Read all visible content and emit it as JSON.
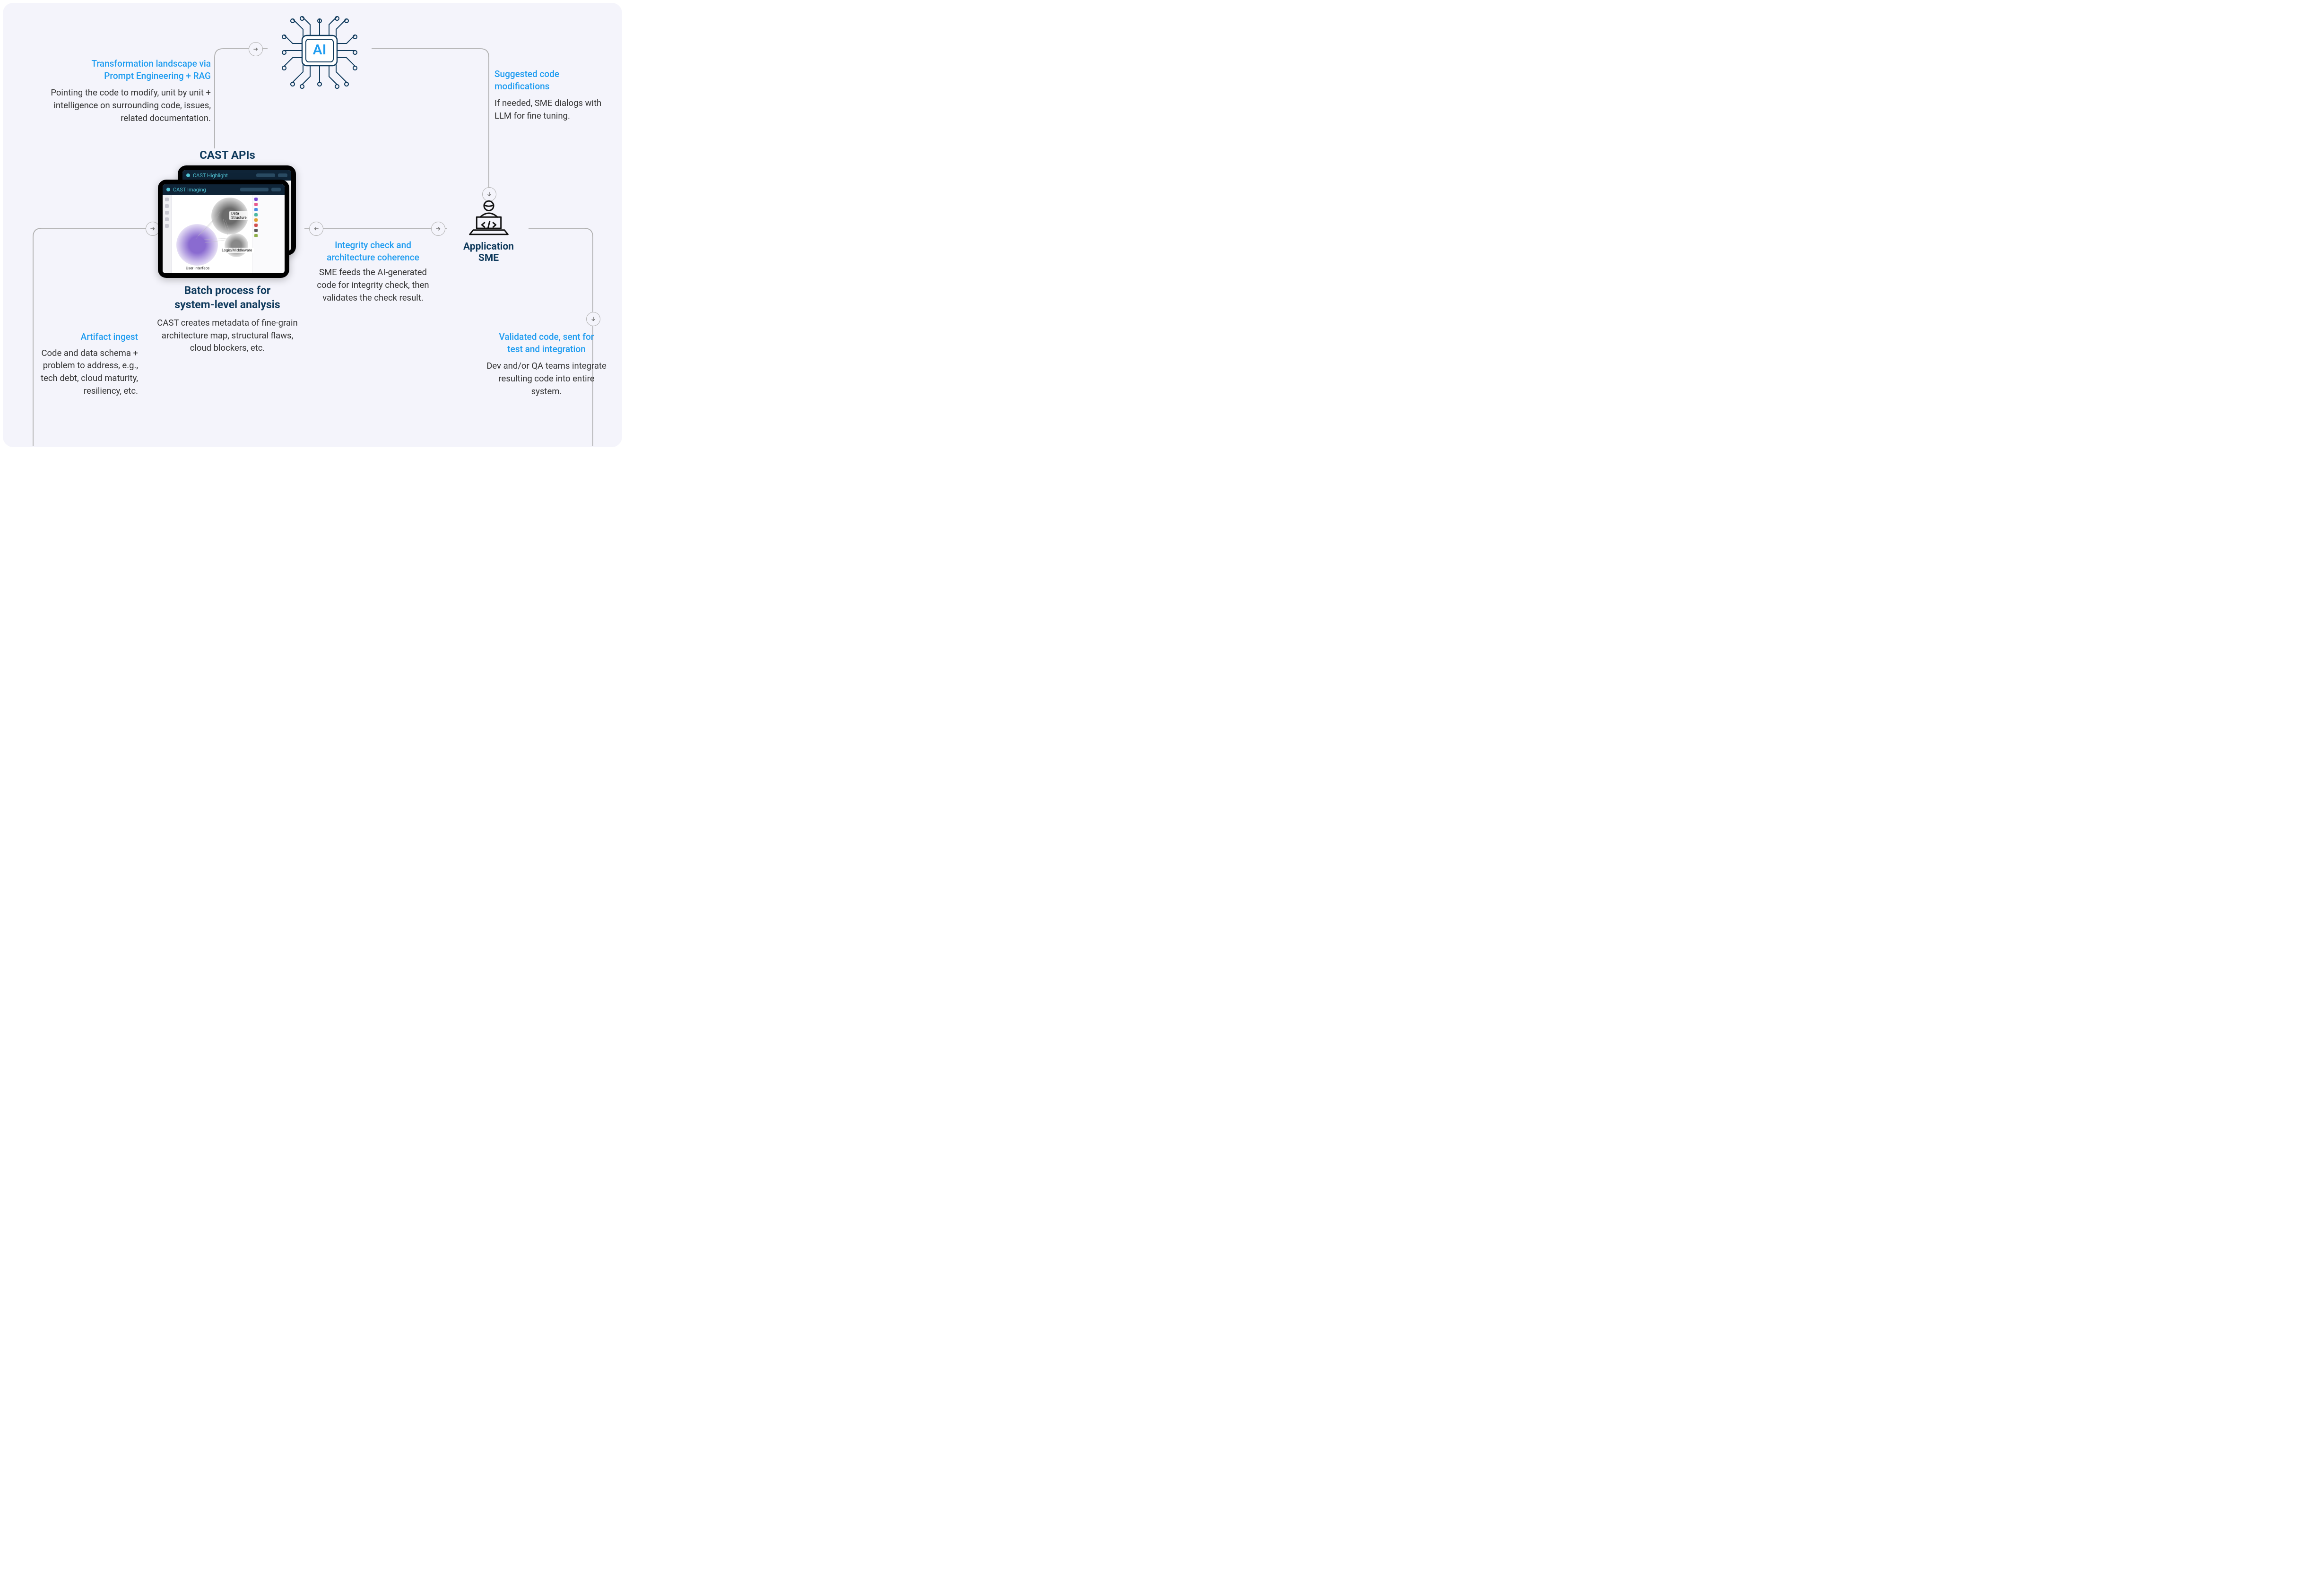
{
  "nodes": {
    "ai": {
      "chip_label": "AI"
    },
    "cast_apis": {
      "heading": "CAST APIs",
      "batch_heading_1": "Batch process for",
      "batch_heading_2": "system-level analysis",
      "batch_body": "CAST creates metadata of fine-grain architecture map, structural flaws, cloud blockers, etc.",
      "tablet_front_title": "CAST Imaging",
      "tablet_back_title": "CAST Highlight",
      "cluster_labels": {
        "data_structure": "Data Structure",
        "logic": "Logic/Middleware",
        "ui": "User Interface"
      }
    },
    "sme": {
      "heading_1": "Application",
      "heading_2": "SME"
    }
  },
  "captions": {
    "transformation": {
      "title_1": "Transformation landscape via",
      "title_2": "Prompt Engineering + RAG",
      "body": "Pointing the code to modify, unit by unit + intelligence on surrounding code, issues, related documentation."
    },
    "suggested": {
      "title_1": "Suggested code",
      "title_2": "modifications",
      "body": "If needed, SME dialogs with LLM for fine tuning."
    },
    "artifact": {
      "title": "Artifact ingest",
      "body": "Code and data schema + problem to address, e.g., tech debt, cloud maturity, resiliency, etc."
    },
    "integrity": {
      "title_1": "Integrity check and",
      "title_2": "architecture coherence",
      "body": "SME feeds the AI-generated code for integrity check, then validates the check result."
    },
    "validated": {
      "title_1": "Validated code, sent for",
      "title_2": "test and integration",
      "body": "Dev and/or QA teams integrate resulting code into entire system."
    }
  },
  "legend": {
    "items": [
      {
        "color": "#7a4bd4"
      },
      {
        "color": "#e95b8e"
      },
      {
        "color": "#4a8de4"
      },
      {
        "color": "#4ab8a3"
      },
      {
        "color": "#e0a030"
      },
      {
        "color": "#d15050"
      },
      {
        "color": "#5a5a5a"
      },
      {
        "color": "#8fb04a"
      }
    ]
  }
}
